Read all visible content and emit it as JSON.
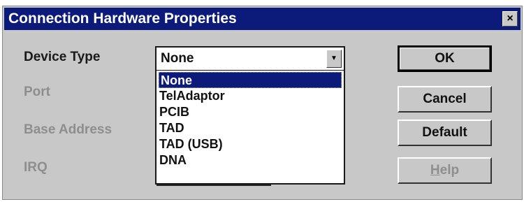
{
  "window": {
    "title": "Connection Hardware Properties",
    "close_glyph": "×"
  },
  "fields": {
    "device_type_label": "Device Type",
    "port_label": "Port",
    "base_address_label": "Base Address",
    "irq_label": "IRQ"
  },
  "device_type": {
    "selected": "None",
    "options": [
      "None",
      "TelAdaptor",
      "PCIB",
      "TAD",
      "TAD (USB)",
      "DNA"
    ]
  },
  "buttons": {
    "ok": "OK",
    "cancel": "Cancel",
    "default": "Default",
    "help_mnemonic": "H",
    "help_rest": "elp"
  }
}
